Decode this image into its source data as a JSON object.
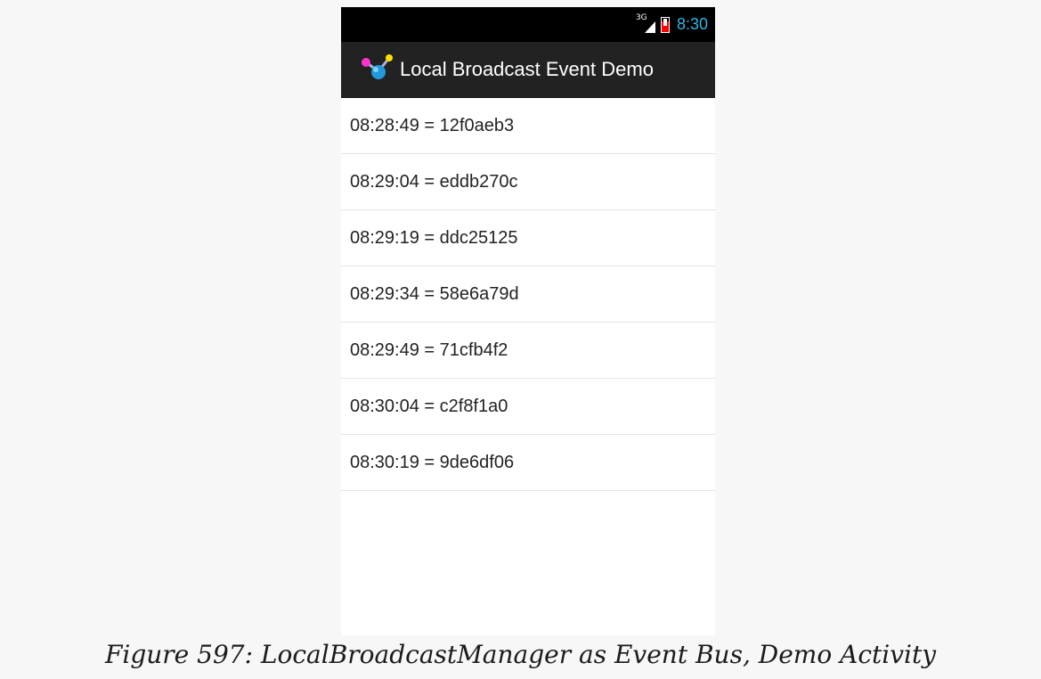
{
  "statusbar": {
    "network_label": "3G",
    "time": "8:30"
  },
  "actionbar": {
    "title": "Local Broadcast Event Demo"
  },
  "list": {
    "items": [
      "08:28:49 = 12f0aeb3",
      "08:29:04 = eddb270c",
      "08:29:19 = ddc25125",
      "08:29:34 = 58e6a79d",
      "08:29:49 = 71cfb4f2",
      "08:30:04 = c2f8f1a0",
      "08:30:19 = 9de6df06"
    ]
  },
  "caption": "Figure 597: LocalBroadcastManager as Event Bus, Demo Activity",
  "colors": {
    "statusbar_bg": "#000000",
    "clock": "#33b5e5",
    "actionbar_bg": "#222222",
    "battery_low": "#ff0000",
    "divider": "#e4e4e4"
  },
  "icons": {
    "app": "molecule-icon",
    "signal": "signal-icon",
    "battery": "battery-icon"
  }
}
